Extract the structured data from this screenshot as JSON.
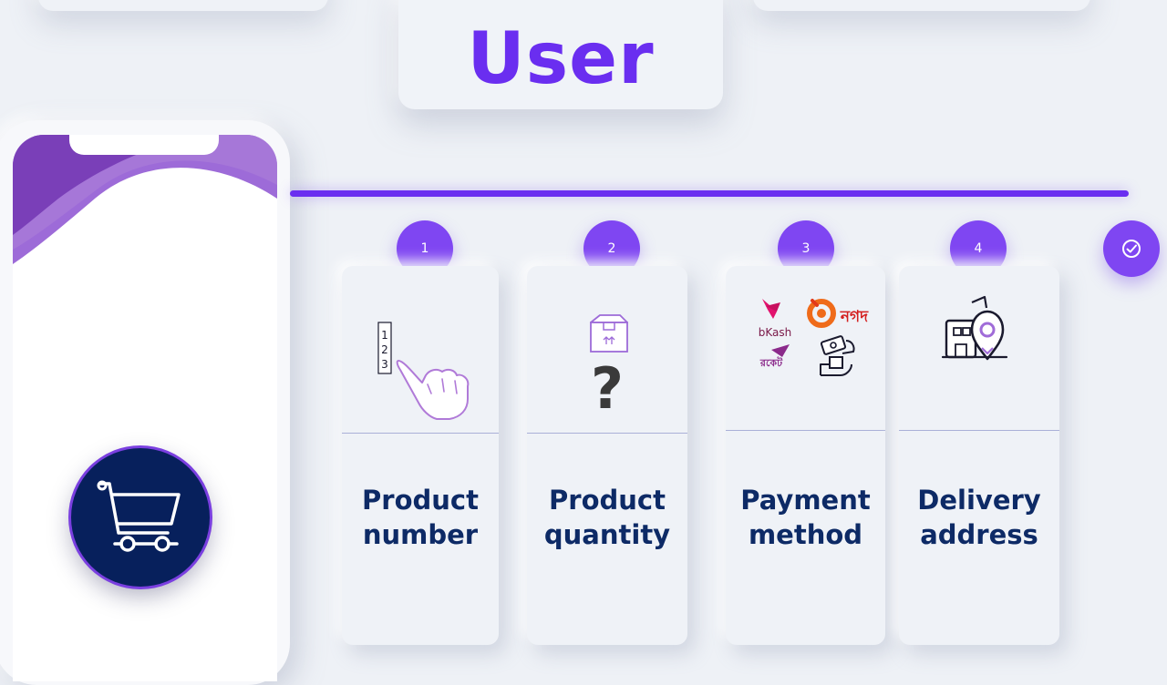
{
  "title": "User",
  "steps": [
    {
      "number": "1",
      "label_line1": "Product",
      "label_line2": "number",
      "icon": "hand-pointer-list-icon",
      "list_numbers": [
        "1",
        "2",
        "3"
      ]
    },
    {
      "number": "2",
      "label_line1": "Product",
      "label_line2": "quantity",
      "icon": "box-question-icon",
      "question_mark": "?"
    },
    {
      "number": "3",
      "label_line1": "Payment",
      "label_line2": "method",
      "icon": "payment-logos-icon",
      "logos": {
        "bkash": "bKash",
        "nagad": "নগদ",
        "rocket": "রকেট"
      }
    },
    {
      "number": "4",
      "label_line1": "Delivery",
      "label_line2": "address",
      "icon": "location-building-icon"
    }
  ],
  "final_step_icon": "check-icon",
  "phone_icon": "shopping-cart-icon",
  "colors": {
    "accent": "#6a2ef0",
    "badge": "#7f46f2",
    "label": "#0d2a66",
    "cart_circle": "#07205c",
    "background": "#eef1f6"
  }
}
